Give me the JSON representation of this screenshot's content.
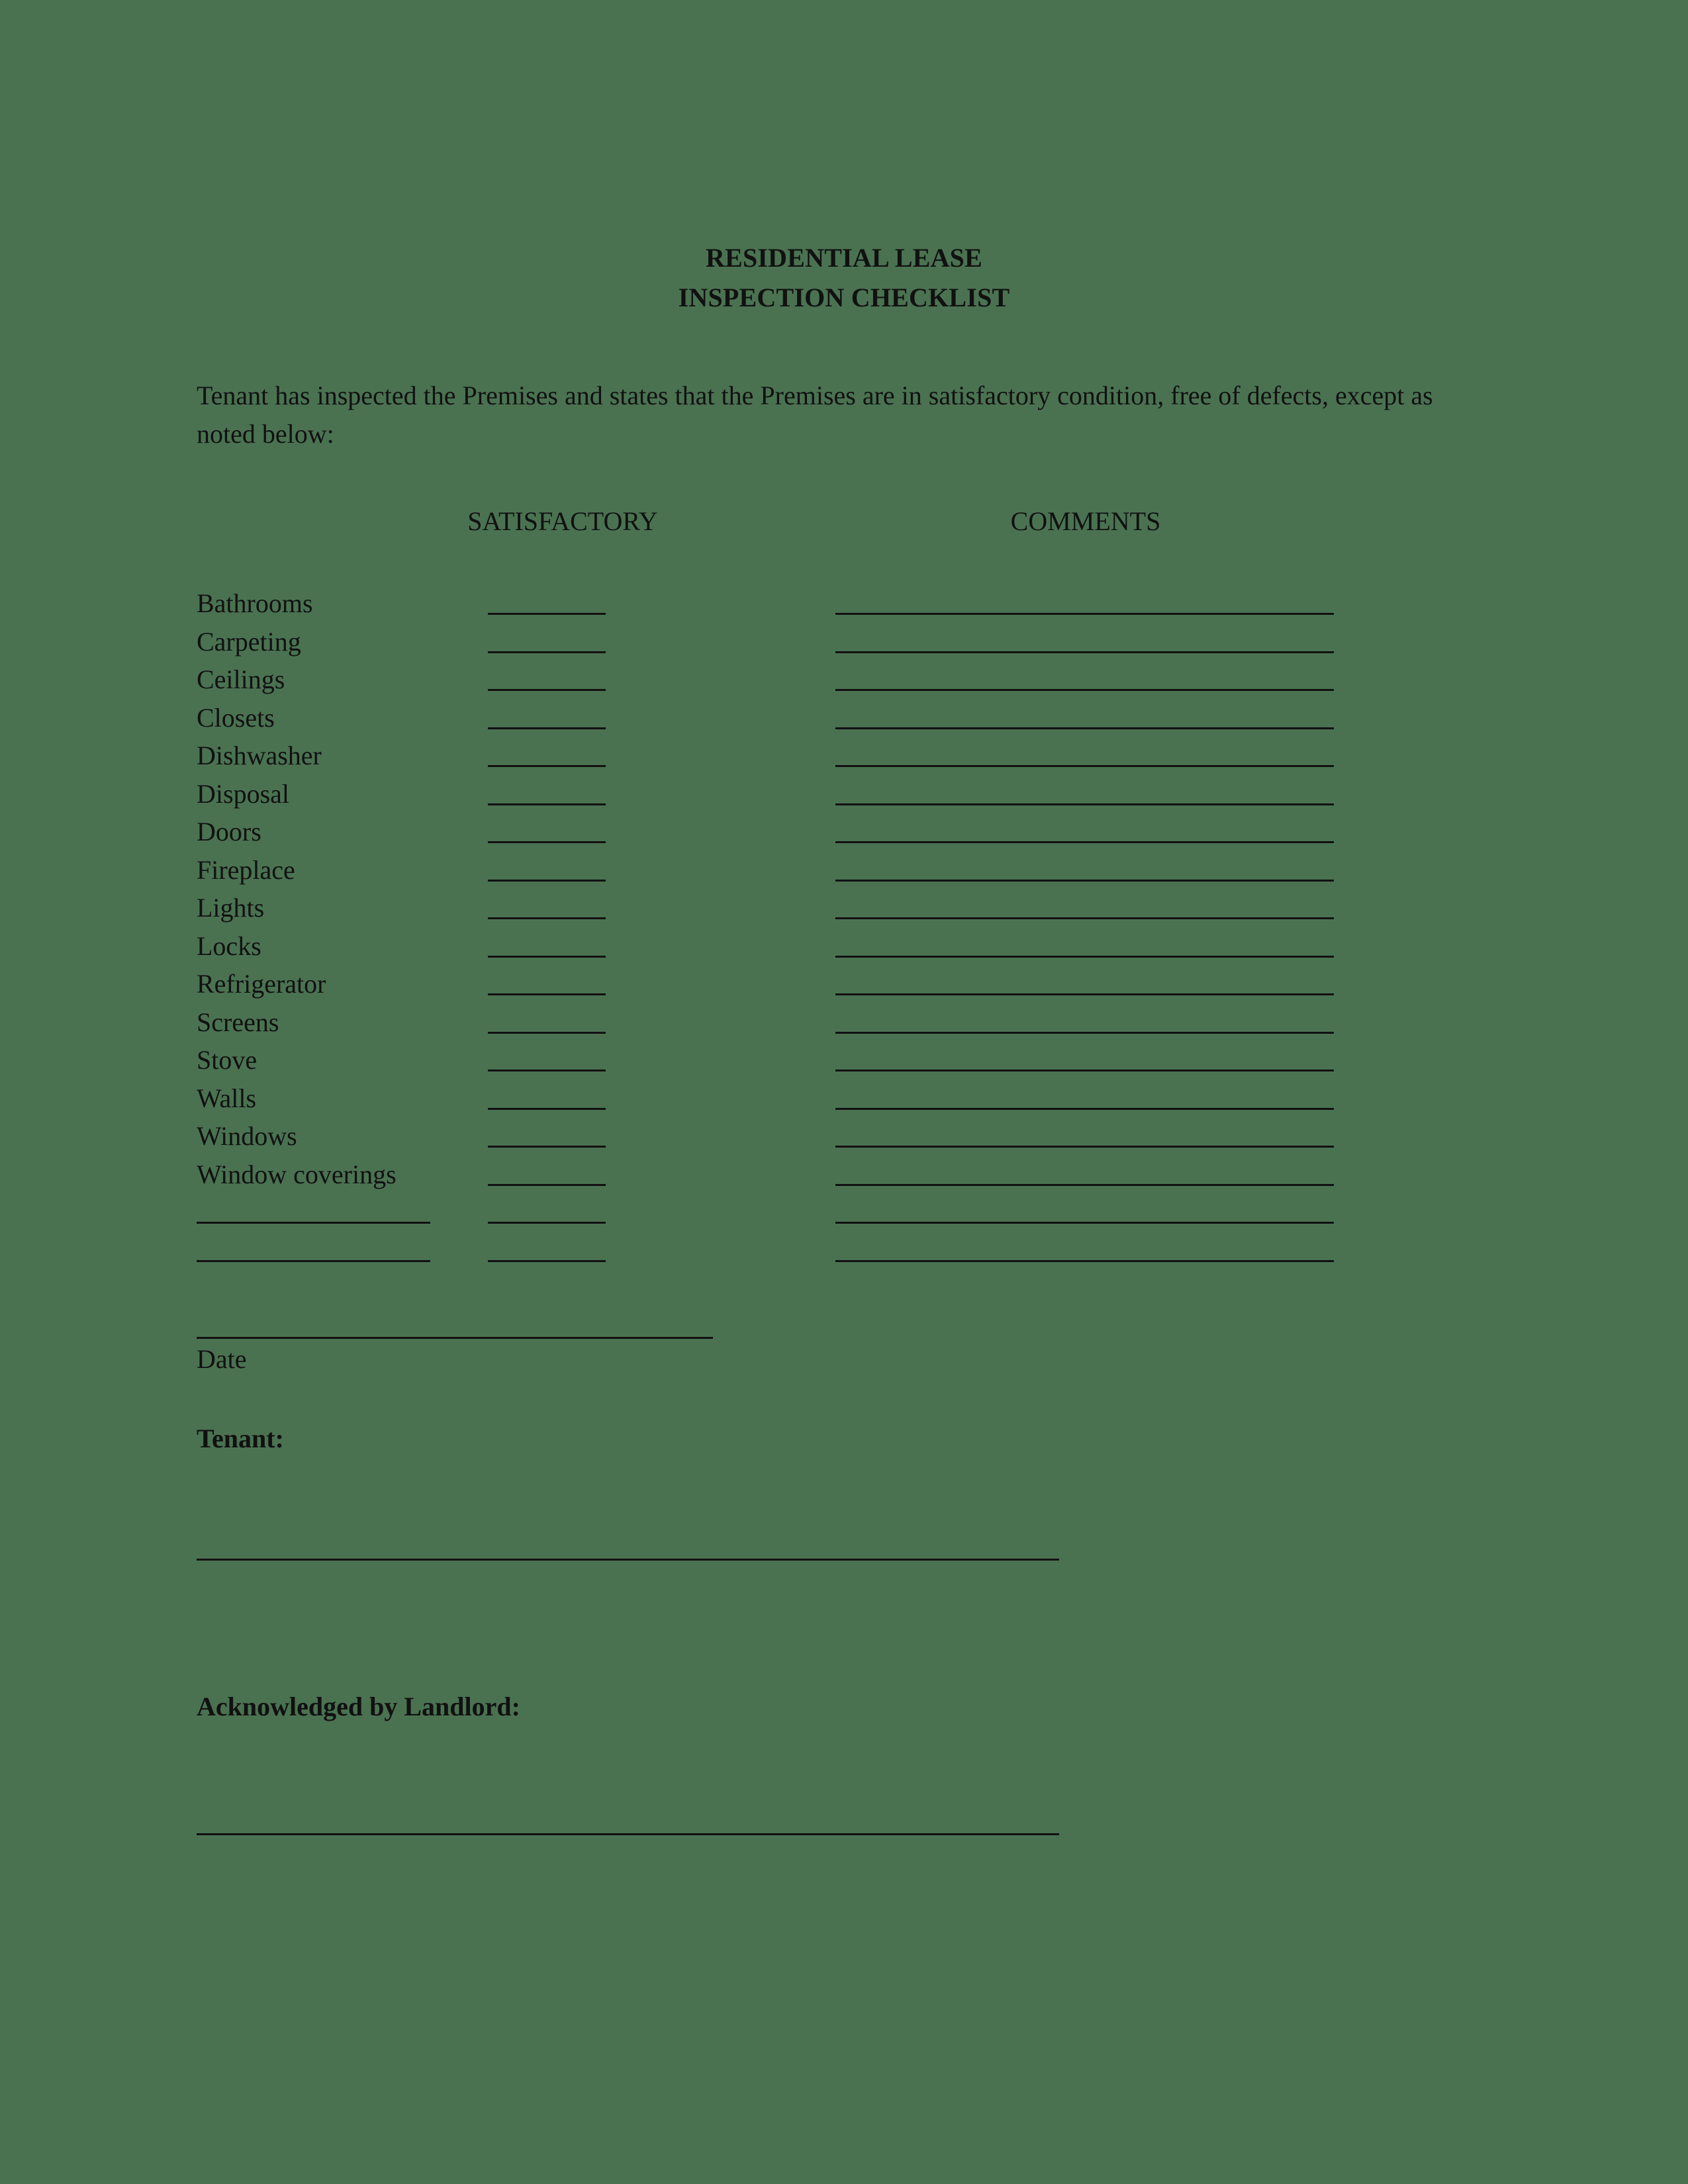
{
  "document": {
    "background_color": "#4a7251",
    "text_color": "#111111",
    "title_line_1": "RESIDENTIAL LEASE",
    "title_line_2": "INSPECTION CHECKLIST",
    "intro_paragraph": "Tenant has inspected the Premises and states that the Premises are in satisfactory condition, free of defects, except as noted below:"
  },
  "columns": {
    "satisfactory_header": "SATISFACTORY",
    "comments_header": "COMMENTS"
  },
  "checklist": {
    "items": [
      {
        "label": "Bathrooms",
        "satisfactory": "",
        "comments": ""
      },
      {
        "label": "Carpeting",
        "satisfactory": "",
        "comments": ""
      },
      {
        "label": "Ceilings",
        "satisfactory": "",
        "comments": ""
      },
      {
        "label": "Closets",
        "satisfactory": "",
        "comments": ""
      },
      {
        "label": "Dishwasher",
        "satisfactory": "",
        "comments": ""
      },
      {
        "label": "Disposal",
        "satisfactory": "",
        "comments": ""
      },
      {
        "label": "Doors",
        "satisfactory": "",
        "comments": ""
      },
      {
        "label": "Fireplace",
        "satisfactory": "",
        "comments": ""
      },
      {
        "label": "Lights",
        "satisfactory": "",
        "comments": ""
      },
      {
        "label": "Locks",
        "satisfactory": "",
        "comments": ""
      },
      {
        "label": "Refrigerator",
        "satisfactory": "",
        "comments": ""
      },
      {
        "label": "Screens",
        "satisfactory": "",
        "comments": ""
      },
      {
        "label": "Stove",
        "satisfactory": "",
        "comments": ""
      },
      {
        "label": "Walls",
        "satisfactory": "",
        "comments": ""
      },
      {
        "label": "Windows",
        "satisfactory": "",
        "comments": ""
      },
      {
        "label": "Window coverings",
        "satisfactory": "",
        "comments": ""
      },
      {
        "label": "",
        "satisfactory": "",
        "comments": ""
      },
      {
        "label": "",
        "satisfactory": "",
        "comments": ""
      }
    ]
  },
  "date_field": {
    "label": "Date",
    "value": ""
  },
  "signatures": {
    "tenant_heading": "Tenant:",
    "tenant_value": "",
    "landlord_heading": "Acknowledged by Landlord:",
    "landlord_value": ""
  }
}
